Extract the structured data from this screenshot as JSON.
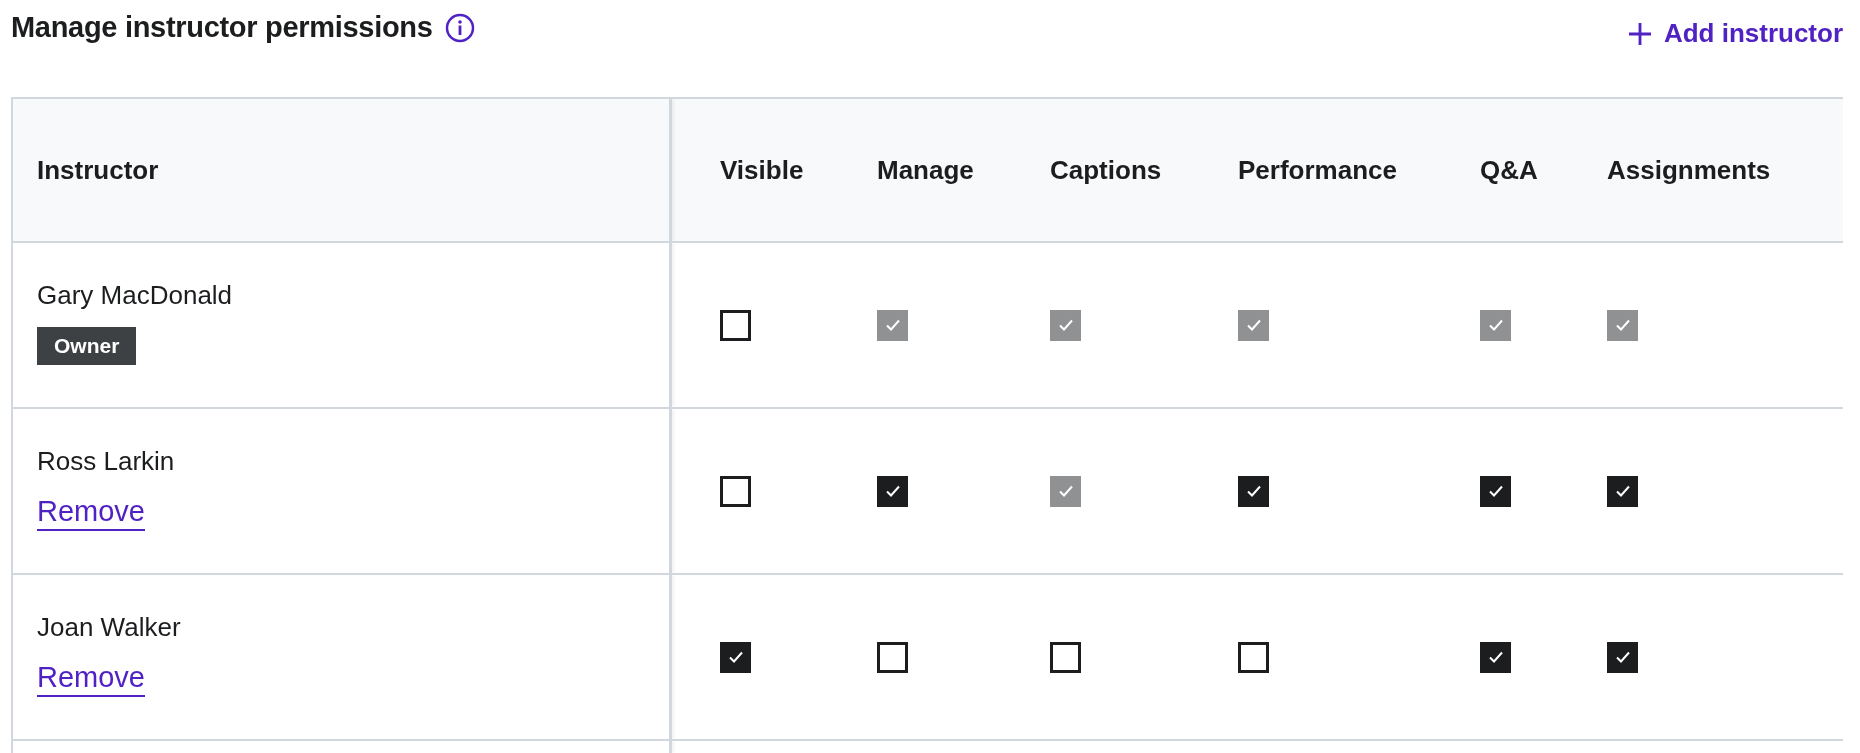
{
  "title": "Manage instructor permissions",
  "add_button": {
    "label": "Add instructor"
  },
  "table": {
    "columns": [
      "Instructor",
      "Visible",
      "Manage",
      "Captions",
      "Performance",
      "Q&A",
      "Assignments"
    ],
    "rows": [
      {
        "name": "Gary MacDonald",
        "tag": {
          "kind": "badge",
          "label": "Owner"
        },
        "permissions": [
          {
            "checked": false,
            "disabled": false
          },
          {
            "checked": true,
            "disabled": true
          },
          {
            "checked": true,
            "disabled": true
          },
          {
            "checked": true,
            "disabled": true
          },
          {
            "checked": true,
            "disabled": true
          },
          {
            "checked": true,
            "disabled": true
          }
        ]
      },
      {
        "name": "Ross Larkin",
        "tag": {
          "kind": "link",
          "label": "Remove"
        },
        "permissions": [
          {
            "checked": false,
            "disabled": false
          },
          {
            "checked": true,
            "disabled": false
          },
          {
            "checked": true,
            "disabled": true
          },
          {
            "checked": true,
            "disabled": false
          },
          {
            "checked": true,
            "disabled": false
          },
          {
            "checked": true,
            "disabled": false
          }
        ]
      },
      {
        "name": "Joan Walker",
        "tag": {
          "kind": "link",
          "label": "Remove"
        },
        "permissions": [
          {
            "checked": true,
            "disabled": false
          },
          {
            "checked": false,
            "disabled": false
          },
          {
            "checked": false,
            "disabled": false
          },
          {
            "checked": false,
            "disabled": false
          },
          {
            "checked": true,
            "disabled": false
          },
          {
            "checked": true,
            "disabled": false
          }
        ]
      }
    ]
  }
}
